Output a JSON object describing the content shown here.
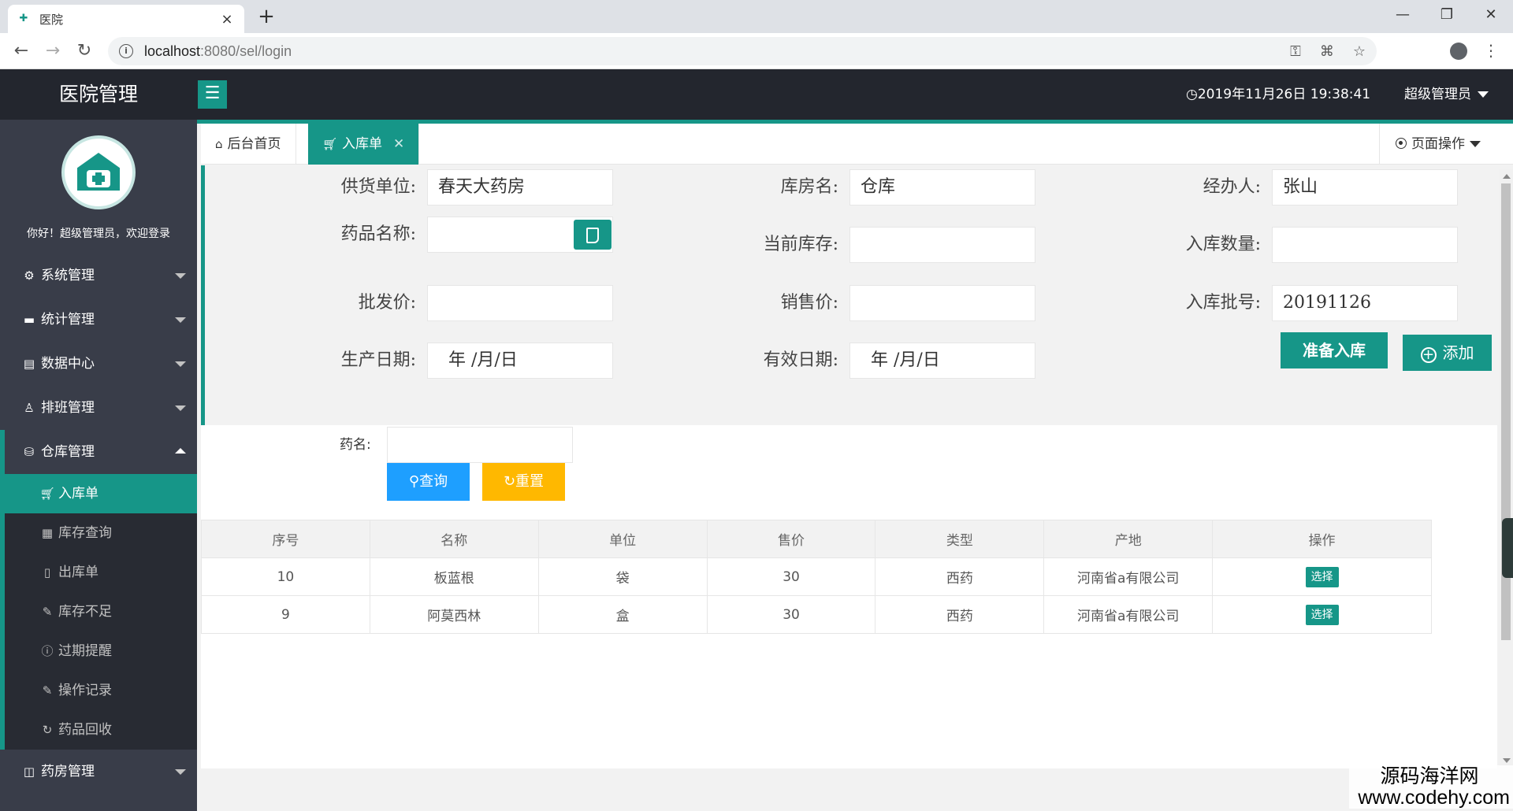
{
  "browser": {
    "tab_title": "医院",
    "url_host": "localhost",
    "url_path": ":8080/sel/login"
  },
  "header": {
    "logo": "医院管理",
    "datetime": "2019年11月26日 19:38:41",
    "user": "超级管理员"
  },
  "sidebar": {
    "welcome": "你好！超级管理员，欢迎登录",
    "items": [
      {
        "label": "系统管理",
        "icon": "gear-icon"
      },
      {
        "label": "统计管理",
        "icon": "monitor-icon"
      },
      {
        "label": "数据中心",
        "icon": "document-icon"
      },
      {
        "label": "排班管理",
        "icon": "user-icon"
      },
      {
        "label": "仓库管理",
        "icon": "warehouse-icon"
      },
      {
        "label": "药房管理",
        "icon": "book-icon"
      }
    ],
    "sub_items": [
      {
        "label": "入库单",
        "icon": "cart-icon"
      },
      {
        "label": "库存查询",
        "icon": "calendar-icon"
      },
      {
        "label": "出库单",
        "icon": "file-icon"
      },
      {
        "label": "库存不足",
        "icon": "edit-icon"
      },
      {
        "label": "过期提醒",
        "icon": "info-icon"
      },
      {
        "label": "操作记录",
        "icon": "edit-icon"
      },
      {
        "label": "药品回收",
        "icon": "refresh-icon"
      }
    ]
  },
  "tabs": {
    "home": "后台首页",
    "current": "入库单",
    "page_ops": "页面操作"
  },
  "form": {
    "supplier_label": "供货单位:",
    "supplier_value": "春天大药房",
    "warehouse_label": "库房名:",
    "warehouse_value": "仓库",
    "handler_label": "经办人:",
    "handler_value": "张山",
    "drug_name_label": "药品名称:",
    "stock_label": "当前库存:",
    "in_qty_label": "入库数量:",
    "wholesale_label": "批发价:",
    "sale_price_label": "销售价:",
    "batch_label": "入库批号:",
    "batch_value": "20191126",
    "prod_date_label": "生产日期:",
    "prod_date_placeholder": "年 /月/日",
    "expiry_label": "有效日期:",
    "expiry_placeholder": "年 /月/日",
    "prepare_button": "准备入库",
    "add_button": "添加"
  },
  "search": {
    "label": "药名:",
    "query_button": "查询",
    "reset_button": "重置"
  },
  "table": {
    "columns": [
      "序号",
      "名称",
      "单位",
      "售价",
      "类型",
      "产地",
      "操作"
    ],
    "rows": [
      [
        "10",
        "板蓝根",
        "袋",
        "30",
        "西药",
        "河南省a有限公司",
        "选择"
      ],
      [
        "9",
        "阿莫西林",
        "盒",
        "30",
        "西药",
        "河南省a有限公司",
        "选择"
      ]
    ]
  },
  "watermark": {
    "line1": "源码海洋网",
    "line2": "www.codehy.com"
  },
  "colors": {
    "brand": "#169688",
    "header_bg": "#23262e",
    "sidebar_bg": "#393d49",
    "query_blue": "#1e9fff",
    "reset_orange": "#ffb800"
  }
}
